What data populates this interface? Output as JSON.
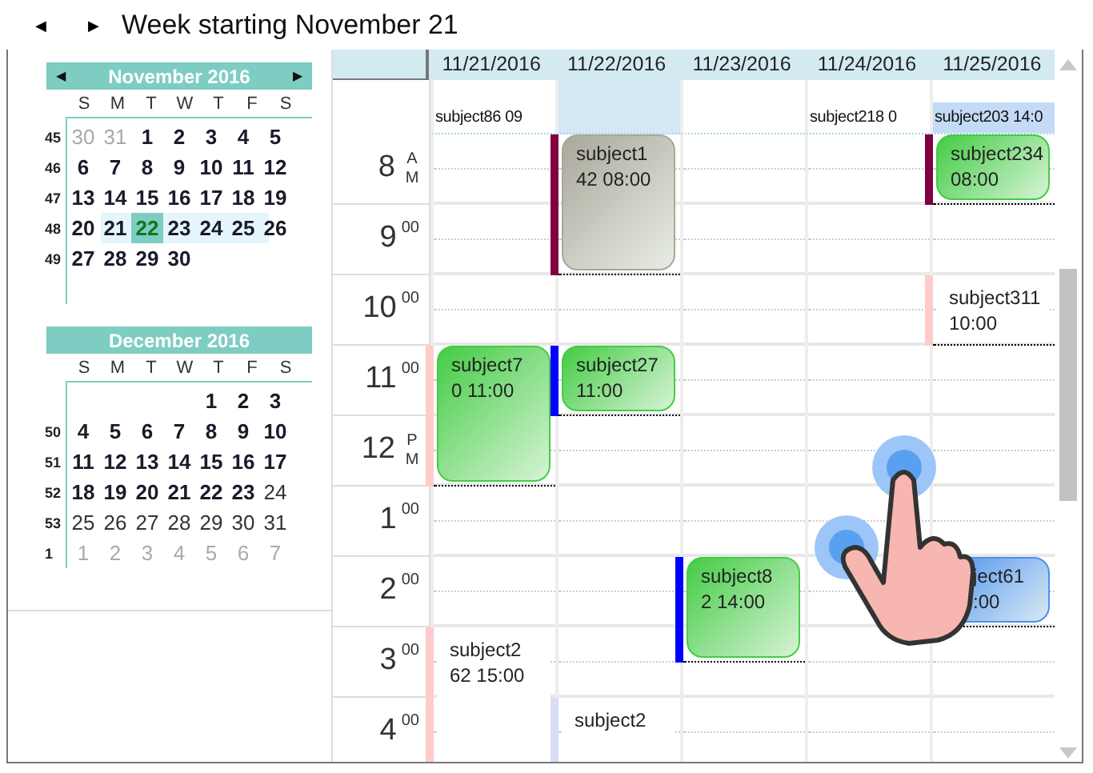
{
  "toolbar": {
    "prev": "◀",
    "next": "▶",
    "title": "Week starting November 21"
  },
  "mini_calendars": [
    {
      "title": "November 2016",
      "prev": "◀",
      "next": "▶",
      "weekdays": [
        "S",
        "M",
        "T",
        "W",
        "T",
        "F",
        "S"
      ],
      "weeks": [
        {
          "number": "45",
          "highlighted": false,
          "days": [
            {
              "text": "30",
              "muted": true,
              "bold": false,
              "selected": false
            },
            {
              "text": "31",
              "muted": true,
              "bold": false,
              "selected": false
            },
            {
              "text": "1",
              "muted": false,
              "bold": true,
              "selected": false
            },
            {
              "text": "2",
              "muted": false,
              "bold": true,
              "selected": false
            },
            {
              "text": "3",
              "muted": false,
              "bold": true,
              "selected": false
            },
            {
              "text": "4",
              "muted": false,
              "bold": true,
              "selected": false
            },
            {
              "text": "5",
              "muted": false,
              "bold": true,
              "selected": false
            }
          ]
        },
        {
          "number": "46",
          "highlighted": false,
          "days": [
            {
              "text": "6",
              "muted": false,
              "bold": true,
              "selected": false
            },
            {
              "text": "7",
              "muted": false,
              "bold": true,
              "selected": false
            },
            {
              "text": "8",
              "muted": false,
              "bold": true,
              "selected": false
            },
            {
              "text": "9",
              "muted": false,
              "bold": true,
              "selected": false
            },
            {
              "text": "10",
              "muted": false,
              "bold": true,
              "selected": false
            },
            {
              "text": "11",
              "muted": false,
              "bold": true,
              "selected": false
            },
            {
              "text": "12",
              "muted": false,
              "bold": true,
              "selected": false
            }
          ]
        },
        {
          "number": "47",
          "highlighted": false,
          "days": [
            {
              "text": "13",
              "muted": false,
              "bold": true,
              "selected": false
            },
            {
              "text": "14",
              "muted": false,
              "bold": true,
              "selected": false
            },
            {
              "text": "15",
              "muted": false,
              "bold": true,
              "selected": false
            },
            {
              "text": "16",
              "muted": false,
              "bold": true,
              "selected": false
            },
            {
              "text": "17",
              "muted": false,
              "bold": true,
              "selected": false
            },
            {
              "text": "18",
              "muted": false,
              "bold": true,
              "selected": false
            },
            {
              "text": "19",
              "muted": false,
              "bold": true,
              "selected": false
            }
          ]
        },
        {
          "number": "48",
          "highlighted": true,
          "days": [
            {
              "text": "20",
              "muted": false,
              "bold": true,
              "selected": false
            },
            {
              "text": "21",
              "muted": false,
              "bold": true,
              "selected": false
            },
            {
              "text": "22",
              "muted": false,
              "bold": true,
              "selected": true
            },
            {
              "text": "23",
              "muted": false,
              "bold": true,
              "selected": false
            },
            {
              "text": "24",
              "muted": false,
              "bold": true,
              "selected": false
            },
            {
              "text": "25",
              "muted": false,
              "bold": true,
              "selected": false
            },
            {
              "text": "26",
              "muted": false,
              "bold": true,
              "selected": false
            }
          ]
        },
        {
          "number": "49",
          "highlighted": false,
          "days": [
            {
              "text": "27",
              "muted": false,
              "bold": true,
              "selected": false
            },
            {
              "text": "28",
              "muted": false,
              "bold": true,
              "selected": false
            },
            {
              "text": "29",
              "muted": false,
              "bold": true,
              "selected": false
            },
            {
              "text": "30",
              "muted": false,
              "bold": true,
              "selected": false
            }
          ]
        }
      ]
    },
    {
      "title": "December 2016",
      "weekdays": [
        "S",
        "M",
        "T",
        "W",
        "T",
        "F",
        "S"
      ],
      "weeks": [
        {
          "highlighted": false,
          "days": [
            {
              "text": "1",
              "muted": false,
              "bold": true,
              "selected": false
            },
            {
              "text": "2",
              "muted": false,
              "bold": true,
              "selected": false
            },
            {
              "text": "3",
              "muted": false,
              "bold": true,
              "selected": false
            }
          ]
        },
        {
          "number": "50",
          "highlighted": false,
          "days": [
            {
              "text": "4",
              "muted": false,
              "bold": true,
              "selected": false
            },
            {
              "text": "5",
              "muted": false,
              "bold": true,
              "selected": false
            },
            {
              "text": "6",
              "muted": false,
              "bold": true,
              "selected": false
            },
            {
              "text": "7",
              "muted": false,
              "bold": true,
              "selected": false
            },
            {
              "text": "8",
              "muted": false,
              "bold": true,
              "selected": false
            },
            {
              "text": "9",
              "muted": false,
              "bold": true,
              "selected": false
            },
            {
              "text": "10",
              "muted": false,
              "bold": true,
              "selected": false
            }
          ]
        },
        {
          "number": "51",
          "highlighted": false,
          "days": [
            {
              "text": "11",
              "muted": false,
              "bold": true,
              "selected": false
            },
            {
              "text": "12",
              "muted": false,
              "bold": true,
              "selected": false
            },
            {
              "text": "13",
              "muted": false,
              "bold": true,
              "selected": false
            },
            {
              "text": "14",
              "muted": false,
              "bold": true,
              "selected": false
            },
            {
              "text": "15",
              "muted": false,
              "bold": true,
              "selected": false
            },
            {
              "text": "16",
              "muted": false,
              "bold": true,
              "selected": false
            },
            {
              "text": "17",
              "muted": false,
              "bold": true,
              "selected": false
            }
          ]
        },
        {
          "number": "52",
          "highlighted": false,
          "days": [
            {
              "text": "18",
              "muted": false,
              "bold": true,
              "selected": false
            },
            {
              "text": "19",
              "muted": false,
              "bold": true,
              "selected": false
            },
            {
              "text": "20",
              "muted": false,
              "bold": true,
              "selected": false
            },
            {
              "text": "21",
              "muted": false,
              "bold": true,
              "selected": false
            },
            {
              "text": "22",
              "muted": false,
              "bold": true,
              "selected": false
            },
            {
              "text": "23",
              "muted": false,
              "bold": true,
              "selected": false
            },
            {
              "text": "24",
              "muted": false,
              "bold": false,
              "selected": false
            }
          ]
        },
        {
          "number": "53",
          "highlighted": false,
          "days": [
            {
              "text": "25",
              "muted": false,
              "bold": false,
              "selected": false
            },
            {
              "text": "26",
              "muted": false,
              "bold": false,
              "selected": false
            },
            {
              "text": "27",
              "muted": false,
              "bold": false,
              "selected": false
            },
            {
              "text": "28",
              "muted": false,
              "bold": false,
              "selected": false
            },
            {
              "text": "29",
              "muted": false,
              "bold": false,
              "selected": false
            },
            {
              "text": "30",
              "muted": false,
              "bold": false,
              "selected": false
            },
            {
              "text": "31",
              "muted": false,
              "bold": false,
              "selected": false
            }
          ]
        },
        {
          "number": "1",
          "highlighted": false,
          "days": [
            {
              "text": "1",
              "muted": true,
              "bold": false,
              "selected": false
            },
            {
              "text": "2",
              "muted": true,
              "bold": false,
              "selected": false
            },
            {
              "text": "3",
              "muted": true,
              "bold": false,
              "selected": false
            },
            {
              "text": "4",
              "muted": true,
              "bold": false,
              "selected": false
            },
            {
              "text": "5",
              "muted": true,
              "bold": false,
              "selected": false
            },
            {
              "text": "6",
              "muted": true,
              "bold": false,
              "selected": false
            },
            {
              "text": "7",
              "muted": true,
              "bold": false,
              "selected": false
            }
          ]
        }
      ]
    }
  ],
  "hours": [
    {
      "hour": "8",
      "suffix": "A M",
      "kind": "ampm"
    },
    {
      "hour": "9",
      "suffix": "00",
      "kind": "minutes"
    },
    {
      "hour": "10",
      "suffix": "00",
      "kind": "minutes"
    },
    {
      "hour": "11",
      "suffix": "00",
      "kind": "minutes"
    },
    {
      "hour": "12",
      "suffix": "P M",
      "kind": "ampm"
    },
    {
      "hour": "1",
      "suffix": "00",
      "kind": "minutes"
    },
    {
      "hour": "2",
      "suffix": "00",
      "kind": "minutes"
    },
    {
      "hour": "3",
      "suffix": "00",
      "kind": "minutes"
    },
    {
      "hour": "4",
      "suffix": "00",
      "kind": "minutes"
    }
  ],
  "days": [
    {
      "date": "11/21/2016",
      "selected": false,
      "all_day": [
        {
          "text": "subject86 09",
          "filled": false
        }
      ],
      "events": [
        {
          "lines": [
            "subject7",
            "0 11:00"
          ],
          "kind": "green",
          "color": "#ffcccc"
        },
        {
          "lines": [
            "subject2",
            "62 15:00"
          ],
          "kind": "plain",
          "color": "#ffcccc"
        }
      ]
    },
    {
      "date": "11/22/2016",
      "selected": true,
      "events": [
        {
          "lines": [
            "subject1",
            "42 08:00"
          ],
          "kind": "gray",
          "color": "#800040"
        },
        {
          "lines": [
            "subject27",
            "11:00"
          ],
          "kind": "green",
          "color": "#0000ff"
        },
        {
          "lines": [
            "subject2"
          ],
          "kind": "plain",
          "color": "#d8def5"
        }
      ]
    },
    {
      "date": "11/23/2016",
      "selected": false,
      "events": [
        {
          "lines": [
            "subject8",
            "2 14:00"
          ],
          "kind": "green",
          "color": "#0000ff"
        }
      ]
    },
    {
      "date": "11/24/2016",
      "selected": false,
      "all_day": [
        {
          "text": "subject218 0",
          "filled": false
        }
      ]
    },
    {
      "date": "11/25/2016",
      "selected": false,
      "all_day": [
        {
          "text": "subject203 14:0",
          "filled": true
        }
      ],
      "events": [
        {
          "lines": [
            "subject234",
            "08:00"
          ],
          "kind": "green",
          "color": "#800040"
        },
        {
          "lines": [
            "subject311",
            "10:00"
          ],
          "kind": "plain",
          "color": "#ffcccc"
        },
        {
          "lines": [
            "ject61",
            ":00"
          ],
          "kind": "blue"
        }
      ]
    }
  ]
}
